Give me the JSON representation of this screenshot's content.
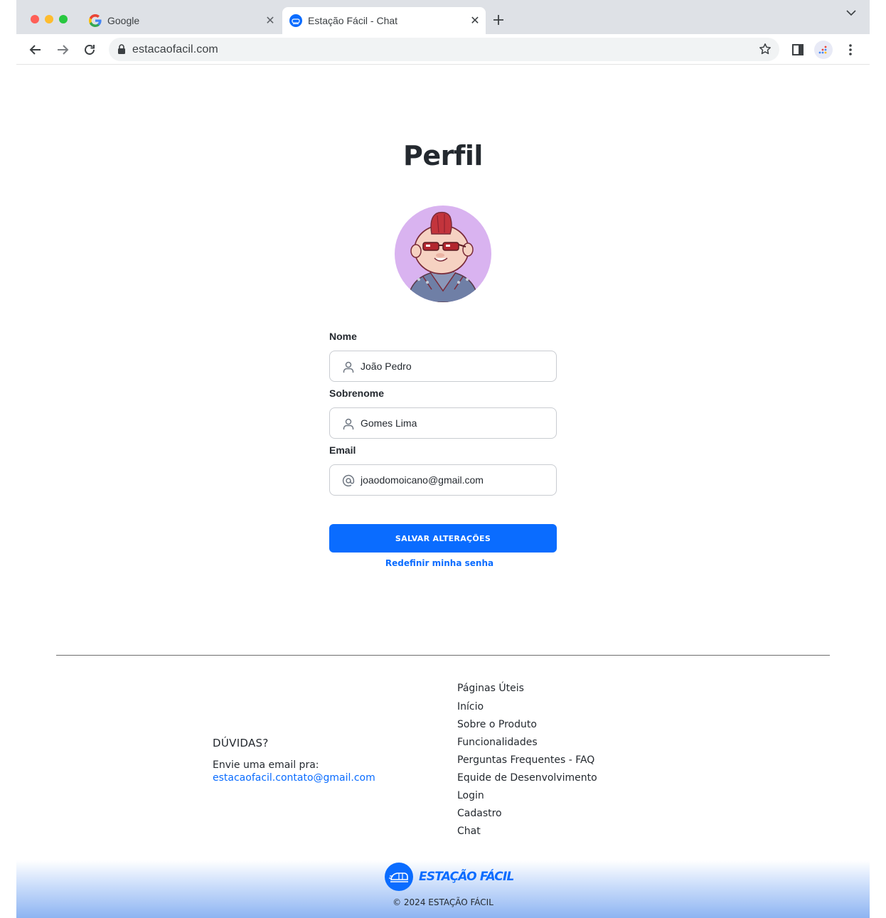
{
  "browser": {
    "tabs": [
      {
        "title": "Google",
        "icon": "google-icon",
        "active": false
      },
      {
        "title": "Estação Fácil - Chat",
        "icon": "estacao-facil-icon",
        "active": true
      }
    ],
    "url": "estacaofacil.com"
  },
  "profile": {
    "title": "Perfil",
    "fields": {
      "nome": {
        "label": "Nome",
        "value": "João Pedro",
        "icon": "user-icon"
      },
      "sobrenome": {
        "label": "Sobrenome",
        "value": "Gomes Lima",
        "icon": "user-icon"
      },
      "email": {
        "label": "Email",
        "value": "joaodomoicano@gmail.com",
        "icon": "at-icon"
      }
    },
    "save_label": "SALVAR ALTERAÇÕES",
    "reset_label": "Redefinir minha senha"
  },
  "footer": {
    "contact": {
      "title": "DÚVIDAS?",
      "text": "Envie uma email pra:",
      "email": "estacaofacil.contato@gmail.com"
    },
    "links": {
      "title": "Páginas Úteis",
      "items": [
        "Início",
        "Sobre o Produto",
        "Funcionalidades",
        "Perguntas Frequentes - FAQ",
        "Equide de Desenvolvimento",
        "Login",
        "Cadastro",
        "Chat"
      ]
    },
    "brand": "ESTAÇÃO FÁCIL",
    "copyright": "© 2024 ESTAÇÃO FÁCIL"
  },
  "colors": {
    "accent": "#0a6cff",
    "avatar_bg": "#d9b3f0",
    "tabstrip": "#dee1e6"
  }
}
